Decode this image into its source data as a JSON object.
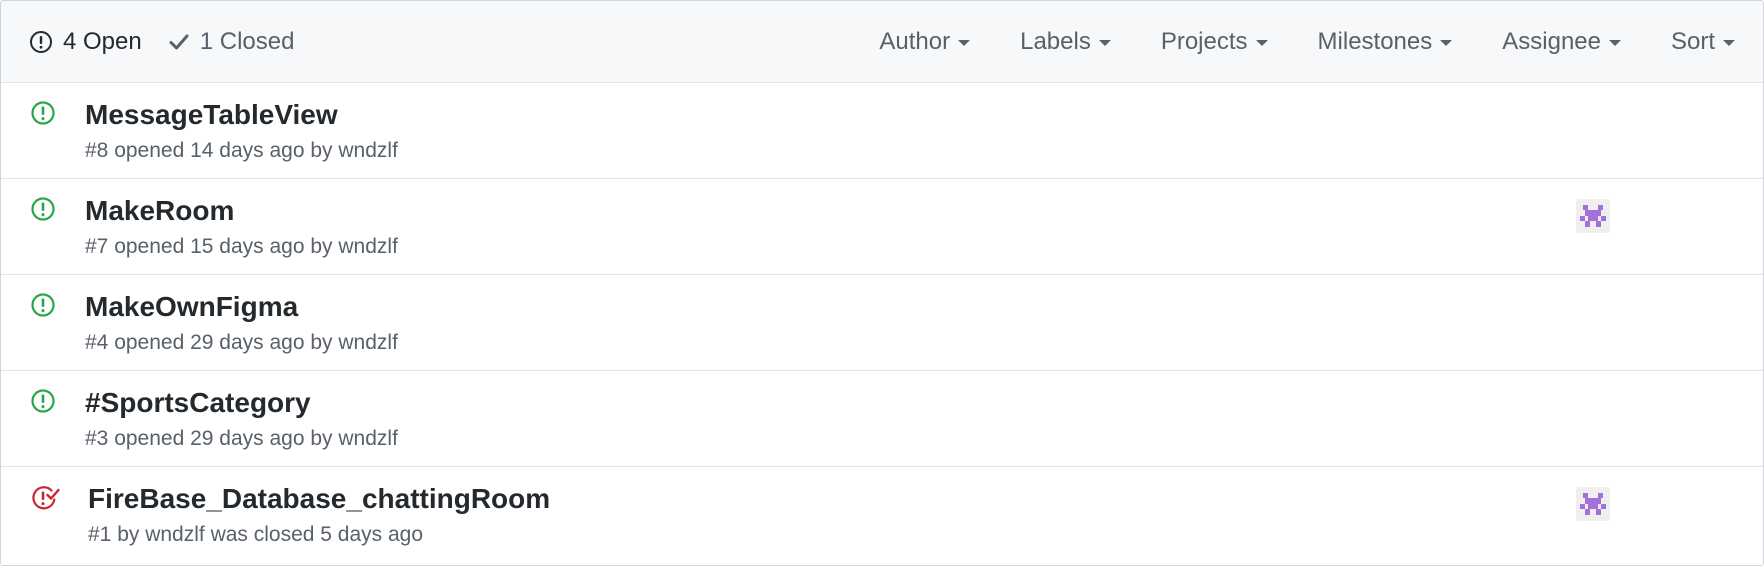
{
  "header": {
    "open_label": "4 Open",
    "closed_label": "1 Closed",
    "filters": [
      "Author",
      "Labels",
      "Projects",
      "Milestones",
      "Assignee",
      "Sort"
    ]
  },
  "issues": [
    {
      "title": "MessageTableView",
      "meta": "#8 opened 14 days ago by wndzlf",
      "state": "open",
      "has_assignee": false
    },
    {
      "title": "MakeRoom",
      "meta": "#7 opened 15 days ago by wndzlf",
      "state": "open",
      "has_assignee": true
    },
    {
      "title": "MakeOwnFigma",
      "meta": "#4 opened 29 days ago by wndzlf",
      "state": "open",
      "has_assignee": false
    },
    {
      "title": "#SportsCategory",
      "meta": "#3 opened 29 days ago by wndzlf",
      "state": "open",
      "has_assignee": false
    },
    {
      "title": "FireBase_Database_chattingRoom",
      "meta": "#1 by wndzlf was closed 5 days ago",
      "state": "closed",
      "has_assignee": true
    }
  ],
  "colors": {
    "open_green": "#28a745",
    "closed_red": "#cb2431",
    "avatar_purple": "#a371d9",
    "avatar_bg": "#efefef"
  },
  "icons": {
    "open_count": "issue-opened-icon",
    "closed_count": "check-icon",
    "issue_open": "issue-opened-icon",
    "issue_closed": "issue-closed-icon",
    "assignee": "identicon-avatar"
  }
}
